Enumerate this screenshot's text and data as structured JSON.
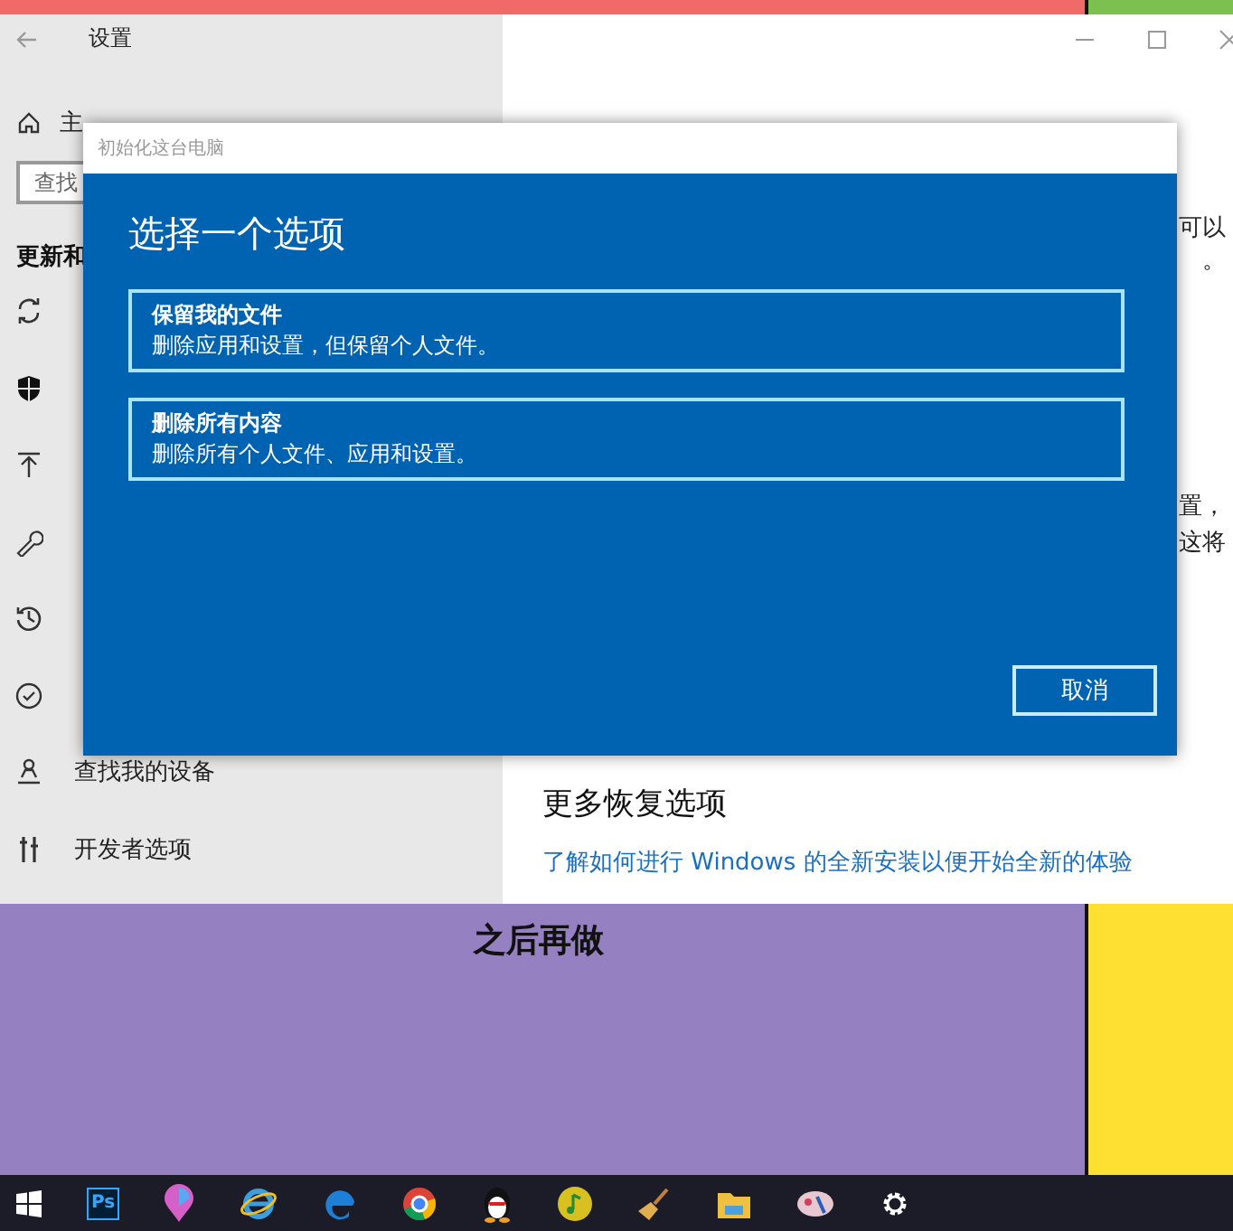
{
  "window": {
    "title": "设置"
  },
  "sidebar": {
    "home": "主",
    "search": {
      "placeholder": "查找"
    },
    "section": "更新和",
    "items": [
      {
        "kind": "sync"
      },
      {
        "kind": "shield"
      },
      {
        "kind": "upload"
      },
      {
        "kind": "wrench"
      },
      {
        "kind": "history"
      },
      {
        "kind": "check"
      },
      {
        "kind": "locate",
        "label": "查找我的设备"
      },
      {
        "kind": "tools",
        "label": "开发者选项"
      }
    ]
  },
  "main": {
    "fragments": [
      {
        "text": "可以"
      },
      {
        "text": "。"
      },
      {
        "text": "置，"
      },
      {
        "text": "这将"
      }
    ],
    "more_heading": "更多恢复选项",
    "link": "了解如何进行 Windows 的全新安装以便开始全新的体验"
  },
  "dialog": {
    "title": "初始化这台电脑",
    "heading": "选择一个选项",
    "options": [
      {
        "title": "保留我的文件",
        "description": "删除应用和设置，但保留个人文件。"
      },
      {
        "title": "删除所有内容",
        "description": "删除所有个人文件、应用和设置。"
      }
    ],
    "cancel": "取消"
  },
  "desktop": {
    "text": "之后再做"
  },
  "taskbar": [
    {
      "kind": "start"
    },
    {
      "kind": "ps",
      "label": "Ps"
    },
    {
      "kind": "drop"
    },
    {
      "kind": "ie"
    },
    {
      "kind": "edge"
    },
    {
      "kind": "chrome"
    },
    {
      "kind": "penguin"
    },
    {
      "kind": "music"
    },
    {
      "kind": "broom"
    },
    {
      "kind": "folder"
    },
    {
      "kind": "paint"
    },
    {
      "kind": "gear"
    }
  ]
}
